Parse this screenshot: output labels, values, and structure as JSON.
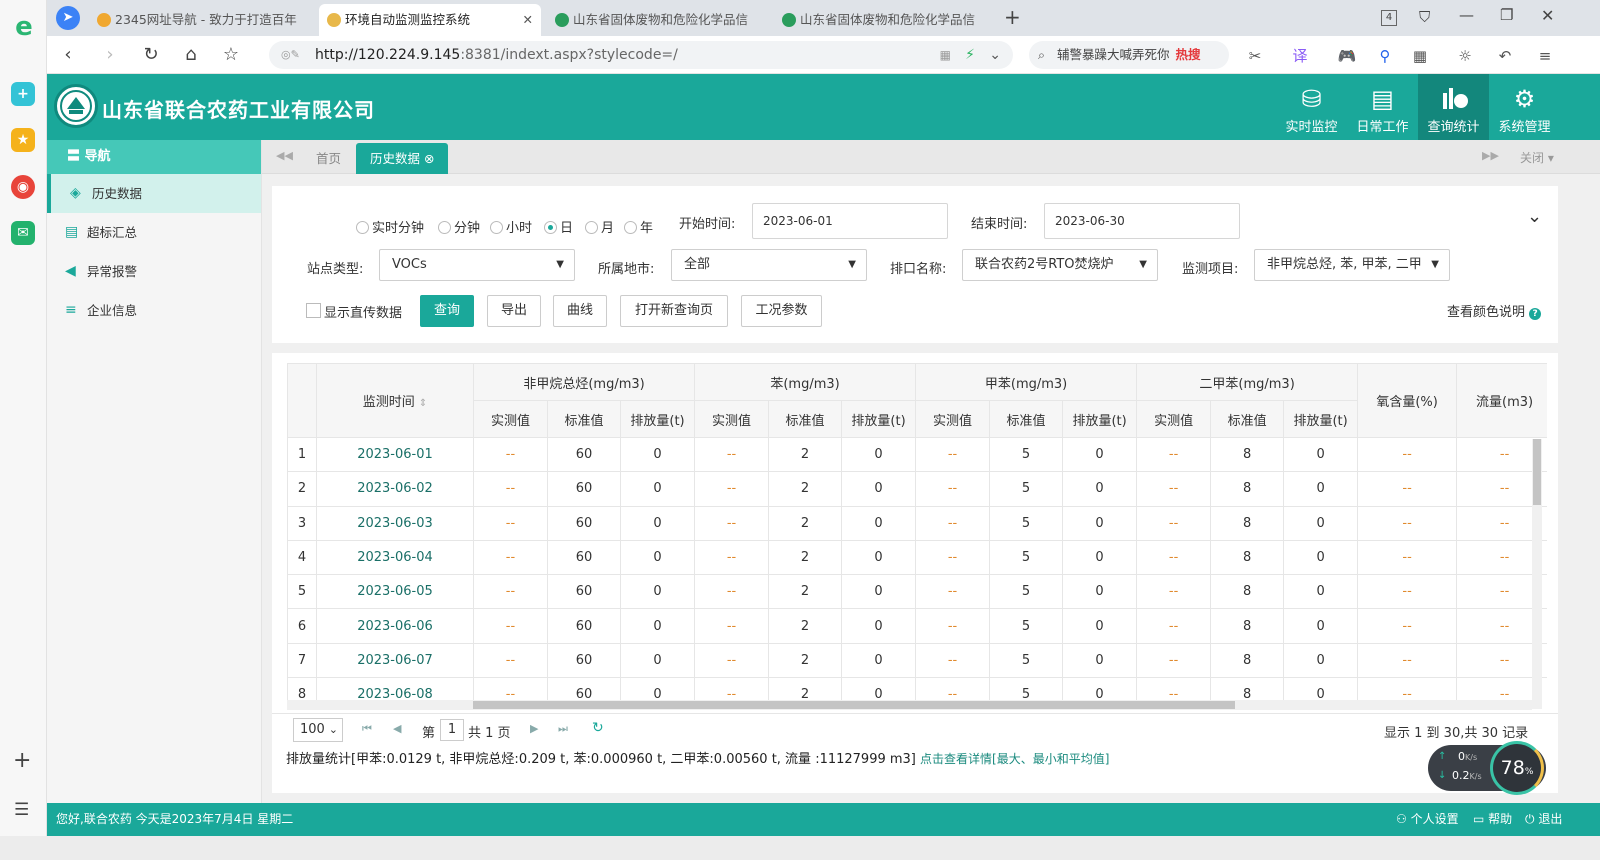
{
  "browser": {
    "tabs": [
      {
        "title": "2345网址导航 - 致力于打造百年",
        "active": false
      },
      {
        "title": "环境自动监测监控系统",
        "active": true
      },
      {
        "title": "山东省固体废物和危险化学品信",
        "active": false
      },
      {
        "title": "山东省固体废物和危险化学品信",
        "active": false
      }
    ],
    "tab_count": "4",
    "url_host": "http://120.224.9.145",
    "url_rest": ":8381/indext.aspx?stylecode=/",
    "search_text": "辅警暴躁大喊弄死你",
    "search_hot": "热搜"
  },
  "app": {
    "company": "山东省联合农药工业有限公司",
    "topnav": [
      {
        "label": "实时监控",
        "icon": "database-icon",
        "active": false
      },
      {
        "label": "日常工作",
        "icon": "printer-icon",
        "active": false
      },
      {
        "label": "查询统计",
        "icon": "chart-icon",
        "active": true
      },
      {
        "label": "系统管理",
        "icon": "gears-icon",
        "active": false
      }
    ]
  },
  "sidebar": {
    "header": "导航",
    "items": [
      {
        "label": "历史数据",
        "active": true
      },
      {
        "label": "超标汇总",
        "active": false
      },
      {
        "label": "异常报警",
        "active": false
      },
      {
        "label": "企业信息",
        "active": false
      }
    ]
  },
  "content_tabs": {
    "home": "首页",
    "current": "历史数据",
    "close": "关闭"
  },
  "filter": {
    "radios": [
      "实时分钟",
      "分钟",
      "小时",
      "日",
      "月",
      "年"
    ],
    "selected_radio": "日",
    "start_label": "开始时间:",
    "start_value": "2023-06-01",
    "end_label": "结束时间:",
    "end_value": "2023-06-30",
    "station_label": "站点类型:",
    "station_value": "VOCs",
    "city_label": "所属地市:",
    "city_value": "全部",
    "outlet_label": "排口名称:",
    "outlet_value": "联合农药2号RTO焚烧炉",
    "item_label": "监测项目:",
    "item_value": "非甲烷总烃, 苯, 甲苯, 二甲",
    "show_direct_label": "显示直传数据",
    "buttons": [
      "查询",
      "导出",
      "曲线",
      "打开新查询页",
      "工况参数"
    ],
    "color_help": "查看颜色说明"
  },
  "table": {
    "time_header": "监测时间",
    "groups": [
      "非甲烷总烃(mg/m3)",
      "苯(mg/m3)",
      "甲苯(mg/m3)",
      "二甲苯(mg/m3)"
    ],
    "sub_headers": [
      "实测值",
      "标准值",
      "排放量(t)"
    ],
    "extra_headers": [
      "氧含量(%)",
      "流量(m3)"
    ],
    "rows": [
      {
        "no": "1",
        "time": "2023-06-01",
        "cells": [
          "--",
          "60",
          "0",
          "--",
          "2",
          "0",
          "--",
          "5",
          "0",
          "--",
          "8",
          "0",
          "--",
          "--"
        ]
      },
      {
        "no": "2",
        "time": "2023-06-02",
        "cells": [
          "--",
          "60",
          "0",
          "--",
          "2",
          "0",
          "--",
          "5",
          "0",
          "--",
          "8",
          "0",
          "--",
          "--"
        ]
      },
      {
        "no": "3",
        "time": "2023-06-03",
        "cells": [
          "--",
          "60",
          "0",
          "--",
          "2",
          "0",
          "--",
          "5",
          "0",
          "--",
          "8",
          "0",
          "--",
          "--"
        ]
      },
      {
        "no": "4",
        "time": "2023-06-04",
        "cells": [
          "--",
          "60",
          "0",
          "--",
          "2",
          "0",
          "--",
          "5",
          "0",
          "--",
          "8",
          "0",
          "--",
          "--"
        ]
      },
      {
        "no": "5",
        "time": "2023-06-05",
        "cells": [
          "--",
          "60",
          "0",
          "--",
          "2",
          "0",
          "--",
          "5",
          "0",
          "--",
          "8",
          "0",
          "--",
          "--"
        ]
      },
      {
        "no": "6",
        "time": "2023-06-06",
        "cells": [
          "--",
          "60",
          "0",
          "--",
          "2",
          "0",
          "--",
          "5",
          "0",
          "--",
          "8",
          "0",
          "--",
          "--"
        ]
      },
      {
        "no": "7",
        "time": "2023-06-07",
        "cells": [
          "--",
          "60",
          "0",
          "--",
          "2",
          "0",
          "--",
          "5",
          "0",
          "--",
          "8",
          "0",
          "--",
          "--"
        ]
      },
      {
        "no": "8",
        "time": "2023-06-08",
        "cells": [
          "--",
          "60",
          "0",
          "--",
          "2",
          "0",
          "--",
          "5",
          "0",
          "--",
          "8",
          "0",
          "--",
          "--"
        ]
      }
    ]
  },
  "pager": {
    "page_size": "100",
    "page_prefix": "第",
    "page_value": "1",
    "page_total": "共 1 页",
    "summary": "显示 1 到 30,共 30 记录"
  },
  "stats": {
    "text": "排放量统计[甲苯:0.0129 t, 非甲烷总烃:0.209 t, 苯:0.000960 t, 二甲苯:0.00560 t, 流量 :11127999 m3]",
    "link": "点击查看详情[最大、最小和平均值]"
  },
  "footer": {
    "greeting": "您好,联合农药 今天是2023年7月4日 星期二",
    "links": [
      "个人设置",
      "帮助",
      "退出"
    ]
  },
  "speed": {
    "up": "0",
    "down": "0.2",
    "unit": "K/s",
    "percent": "78"
  },
  "colors": {
    "accent": "#1aa89a",
    "accent_dark": "#13877c",
    "nav_header": "#45c8b8"
  }
}
